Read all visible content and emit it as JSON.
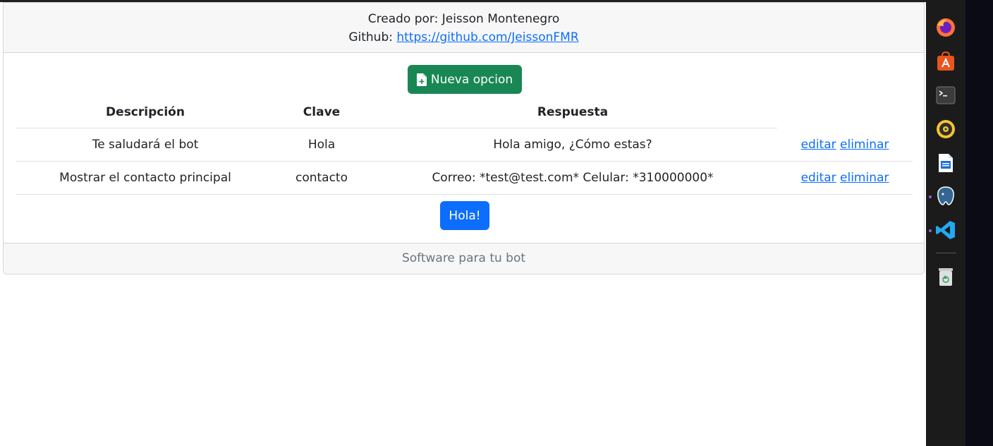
{
  "header": {
    "created_by": "Creado por: Jeisson Montenegro",
    "github_label": "Github:",
    "github_link": "https://github.com/JeissonFMR"
  },
  "actions": {
    "new_option_label": "Nueva opcion",
    "hola_button_label": "Hola!"
  },
  "table": {
    "columns": [
      "Descripción",
      "Clave",
      "Respuesta"
    ],
    "rows": [
      {
        "descripcion": "Te saludará el bot",
        "clave": "Hola",
        "respuesta": "Hola amigo, ¿Cómo estas?",
        "edit_label": "editar",
        "delete_label": "eliminar"
      },
      {
        "descripcion": "Mostrar el contacto principal",
        "clave": "contacto",
        "respuesta": "Correo: *test@test.com* Celular: *310000000*",
        "edit_label": "editar",
        "delete_label": "eliminar"
      }
    ]
  },
  "footer": {
    "text": "Software para tu bot"
  },
  "dock": {
    "icons": [
      "firefox-icon",
      "app-center-icon",
      "terminal-icon",
      "rhythmbox-icon",
      "writer-icon",
      "pgadmin-icon",
      "vscode-icon",
      "trash-icon"
    ]
  },
  "colors": {
    "success": "#198754",
    "primary": "#0d6efd",
    "header_bg": "#f7f7f7"
  }
}
